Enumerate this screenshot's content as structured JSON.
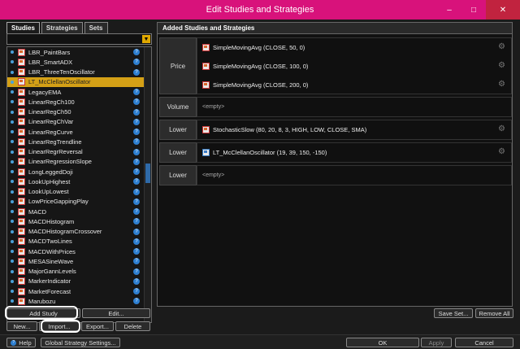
{
  "window": {
    "title": "Edit Studies and Strategies",
    "minimize": "–",
    "maximize": "□",
    "close": "✕"
  },
  "tabs": [
    {
      "label": "Studies"
    },
    {
      "label": "Strategies"
    },
    {
      "label": "Sets"
    }
  ],
  "studies": [
    {
      "label": "LBR_PaintBars"
    },
    {
      "label": "LBR_SmartADX"
    },
    {
      "label": "LBR_ThreeTenOscillator"
    },
    {
      "label": "LT_McClellanOscillator",
      "selected": true
    },
    {
      "label": "LegacyEMA"
    },
    {
      "label": "LinearRegCh100"
    },
    {
      "label": "LinearRegCh50"
    },
    {
      "label": "LinearRegChVar"
    },
    {
      "label": "LinearRegCurve"
    },
    {
      "label": "LinearRegTrendline"
    },
    {
      "label": "LinearRegrReversal"
    },
    {
      "label": "LinearRegressionSlope"
    },
    {
      "label": "LongLeggedDoji"
    },
    {
      "label": "LookUpHighest"
    },
    {
      "label": "LookUpLowest"
    },
    {
      "label": "LowPriceGappingPlay"
    },
    {
      "label": "MACD"
    },
    {
      "label": "MACDHistogram"
    },
    {
      "label": "MACDHistogramCrossover"
    },
    {
      "label": "MACDTwoLines"
    },
    {
      "label": "MACDWithPrices"
    },
    {
      "label": "MESASineWave"
    },
    {
      "label": "MajorGannLevels"
    },
    {
      "label": "MarkerIndicator"
    },
    {
      "label": "MarketForecast"
    },
    {
      "label": "Marubozu"
    }
  ],
  "left_buttons": {
    "add_study": "Add Study",
    "edit": "Edit...",
    "new": "New...",
    "import": "Import...",
    "export": "Export...",
    "delete": "Delete"
  },
  "added": {
    "header": "Added Studies and Strategies",
    "groups": [
      {
        "label": "Price",
        "rows": [
          "SimpleMovingAvg (CLOSE, 50, 0)",
          "SimpleMovingAvg (CLOSE, 100, 0)",
          "SimpleMovingAvg (CLOSE, 200, 0)"
        ]
      },
      {
        "label": "Volume",
        "empty": "<empty>"
      },
      {
        "label": "Lower",
        "rows": [
          "StochasticSlow (80, 20, 8, 3, HIGH, LOW, CLOSE, SMA)"
        ]
      },
      {
        "label": "Lower",
        "rows": [
          "LT_McClellanOscillator (19, 39, 150, -150)"
        ]
      },
      {
        "label": "Lower",
        "empty": "<empty>"
      }
    ]
  },
  "right_buttons": {
    "save_set": "Save Set...",
    "remove_all": "Remove All"
  },
  "bottom": {
    "help": "Help",
    "global": "Global Strategy Settings...",
    "ok": "OK",
    "apply": "Apply",
    "cancel": "Cancel"
  },
  "icons": {
    "help": "help-icon",
    "gear": "gear-icon",
    "info": "info-icon",
    "dropdown": "chevron-down-icon"
  },
  "colors": {
    "titlebar": "#d8127b",
    "selection": "#d4a016",
    "accent": "#2d7fd1"
  }
}
